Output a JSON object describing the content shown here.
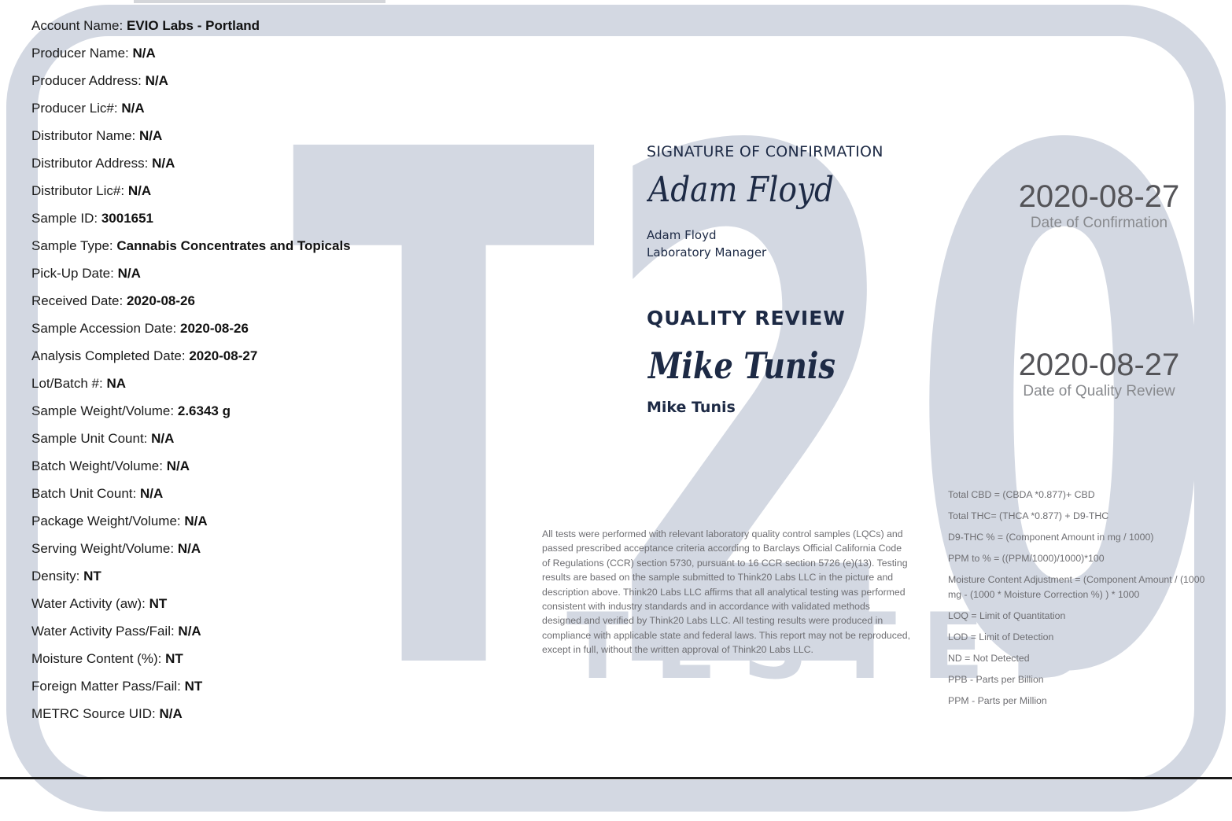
{
  "fields": [
    {
      "label": "Account Name:",
      "value": "EVIO Labs - Portland"
    },
    {
      "label": "Producer Name:",
      "value": "N/A"
    },
    {
      "label": "Producer Address:",
      "value": "N/A"
    },
    {
      "label": "Producer Lic#:",
      "value": "N/A"
    },
    {
      "label": "Distributor Name:",
      "value": "N/A"
    },
    {
      "label": "Distributor Address:",
      "value": "N/A"
    },
    {
      "label": "Distributor Lic#:",
      "value": "N/A"
    },
    {
      "label": "Sample ID:",
      "value": "3001651"
    },
    {
      "label": "Sample Type:",
      "value": "Cannabis Concentrates and Topicals"
    },
    {
      "label": "Pick-Up Date:",
      "value": "N/A"
    },
    {
      "label": "Received Date:",
      "value": "2020-08-26"
    },
    {
      "label": "Sample Accession Date:",
      "value": "2020-08-26"
    },
    {
      "label": "Analysis Completed Date:",
      "value": "2020-08-27"
    },
    {
      "label": "Lot/Batch #:",
      "value": "NA"
    },
    {
      "label": "Sample Weight/Volume:",
      "value": "2.6343 g"
    },
    {
      "label": "Sample Unit Count:",
      "value": "N/A"
    },
    {
      "label": "Batch Weight/Volume:",
      "value": "N/A"
    },
    {
      "label": "Batch Unit Count:",
      "value": "N/A"
    },
    {
      "label": "Package Weight/Volume:",
      "value": "N/A"
    },
    {
      "label": "Serving Weight/Volume:",
      "value": "N/A"
    },
    {
      "label": "Density:",
      "value": "NT"
    },
    {
      "label": "Water Activity (aw):",
      "value": "NT"
    },
    {
      "label": "Water Activity Pass/Fail:",
      "value": "N/A"
    },
    {
      "label": "Moisture Content (%):",
      "value": "NT"
    },
    {
      "label": "Foreign Matter Pass/Fail:",
      "value": "NT"
    },
    {
      "label": "METRC Source UID:",
      "value": "N/A"
    }
  ],
  "confirmation": {
    "heading": "SIGNATURE OF CONFIRMATION",
    "signature_text": "Adam Floyd",
    "name": "Adam Floyd",
    "title": "Laboratory Manager",
    "date": "2020-08-27",
    "date_label": "Date of Confirmation"
  },
  "quality_review": {
    "heading": "QUALITY REVIEW",
    "signature_text": "Mike Tunis",
    "name": "Mike Tunis",
    "date": "2020-08-27",
    "date_label": "Date of Quality Review"
  },
  "disclaimer": "All tests were performed with relevant laboratory quality control samples (LQCs) and passed prescribed acceptance criteria according to Barclays Official California Code of Regulations (CCR) section 5730, pursuant to 16 CCR section 5726 (e)(13). Testing results are based on the sample submitted to Think20 Labs LLC in the picture and description above. Think20 Labs LLC affirms that all analytical testing was performed consistent with industry standards and in accordance with validated methods designed and verified by Think20 Labs LLC. All testing results were produced in compliance with applicable state and federal laws. This report may not be reproduced, except in full, without the written approval of Think20 Labs LLC.",
  "formulas": [
    "Total CBD = (CBDA *0.877)+ CBD",
    "Total THC= (THCA *0.877) + D9-THC",
    "D9-THC % = (Component Amount in mg / 1000)",
    "PPM to % = ((PPM/1000)/1000)*100",
    "Moisture Content Adjustment = (Component Amount / (1000 mg - (1000 * Moisture Correction %) ) * 1000",
    "LOQ = Limit of Quantitation",
    "LOD = Limit of Detection",
    "ND = Not Detected",
    "PPB - Parts per Billion",
    "PPM - Parts per Million"
  ],
  "watermark": {
    "main": "T20",
    "sub": "TESTED",
    "color": "#d3d8e2"
  }
}
